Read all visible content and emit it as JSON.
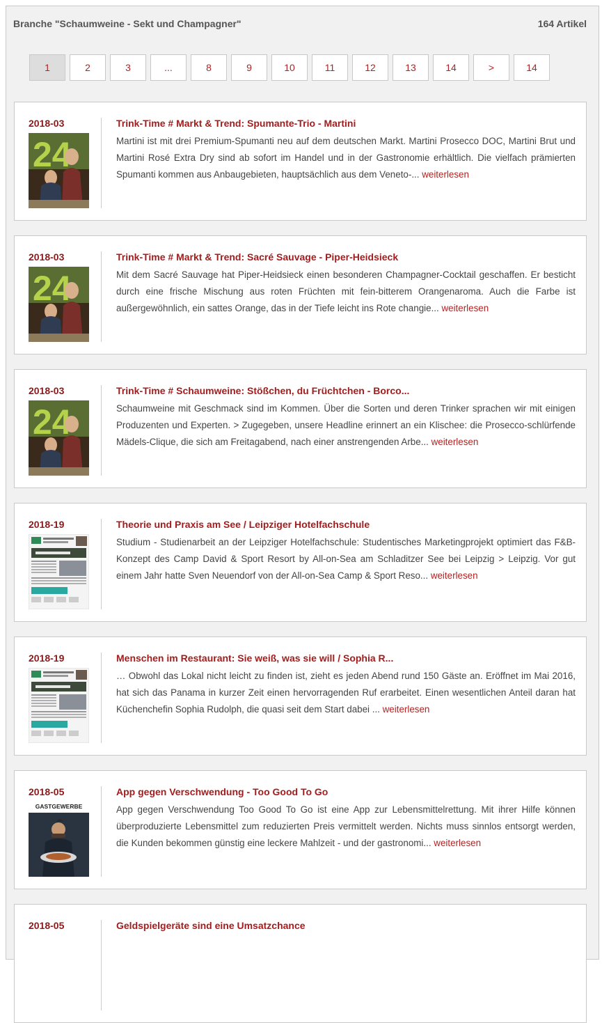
{
  "header": {
    "title": "Branche \"Schaumweine - Sekt und Champagner\"",
    "count": "164 Artikel"
  },
  "pagination": [
    "1",
    "2",
    "3",
    "...",
    "8",
    "9",
    "10",
    "11",
    "12",
    "13",
    "14",
    ">",
    "14"
  ],
  "articles": [
    {
      "date": "2018-03",
      "cover": "magazine-24-cover",
      "title": "Trink-Time # Markt & Trend: Spumante-Trio - Martini",
      "excerpt": "Martini ist mit drei Premium-Spumanti neu auf dem deutschen Markt. Martini Prosecco DOC, Martini Brut und Martini Rosé Extra Dry sind ab sofort im Handel und in der Gastronomie erhältlich. Die vielfach prämierten Spumanti kommen aus Anbaugebieten, hauptsächlich aus dem Veneto-... ",
      "more": "weiterlesen"
    },
    {
      "date": "2018-03",
      "cover": "magazine-24-cover",
      "title": "Trink-Time # Markt & Trend: Sacré Sauvage - Piper-Heidsieck",
      "excerpt": "Mit dem Sacré Sauvage hat Piper-Heidsieck einen besonderen Champagner-Cocktail geschaffen. Er besticht durch eine frische Mischung aus roten Früchten mit fein-bitterem Orangenaroma. Auch die Farbe ist außergewöhnlich, ein sattes Orange, das in der Tiefe leicht ins Rote changie... ",
      "more": "weiterlesen"
    },
    {
      "date": "2018-03",
      "cover": "magazine-24-cover",
      "title": "Trink-Time # Schaumweine: Stößchen, du Früchtchen - Borco...",
      "excerpt": "Schaumweine mit Geschmack sind im Kommen. Über die Sorten und deren Trinker sprachen wir mit einigen Produzenten und Experten. > Zugegeben, unsere Headline erinnert an ein Klischee: die Prosecco-schlürfende Mädels-Clique, die sich am Freitagabend, nach einer anstrengenden Arbe... ",
      "more": "weiterlesen"
    },
    {
      "date": "2018-19",
      "cover": "newspaper-cover",
      "title": "Theorie und Praxis am See / Leipziger Hotelfachschule",
      "excerpt": "Studium - Studienarbeit an der Leipziger Hotelfachschule: Studentisches Marketingprojekt optimiert das F&B-Konzept des Camp David & Sport Resort by All-on-Sea am Schladitzer See bei Leipzig > Leipzig. Vor gut einem Jahr hatte Sven Neuendorf von der All-on-Sea Camp & Sport Reso... ",
      "more": "weiterlesen"
    },
    {
      "date": "2018-19",
      "cover": "newspaper-cover",
      "title": "Menschen im Restaurant: Sie weiß, was sie will / Sophia R...",
      "excerpt": "… Obwohl das Lokal nicht leicht zu finden ist, zieht es jeden Abend rund 150 Gäste an. Eröffnet im Mai 2016, hat sich das Panama in kurzer Zeit einen hervorragenden Ruf erarbeitet. Einen wesentlichen Anteil daran hat Küchenchefin Sophia Rudolph, die quasi seit dem Start dabei ... ",
      "more": "weiterlesen"
    },
    {
      "date": "2018-05",
      "cover": "gastgewerbe-cover",
      "cover_label": "GASTGEWERBE",
      "title": "App gegen Verschwendung - Too Good To Go",
      "excerpt": "App gegen Verschwendung Too Good To Go ist eine App zur Lebensmittelrettung. Mit ihrer Hilfe können überproduzierte Lebensmittel zum reduzierten Preis vermittelt werden. Nichts muss sinnlos entsorgt werden, die Kunden bekommen günstig eine leckere Mahlzeit - und der gastronomi... ",
      "more": "weiterlesen"
    },
    {
      "date": "2018-05",
      "title": "Geldspielgeräte sind eine Umsatzchance",
      "excerpt": "",
      "more": ""
    }
  ],
  "colors": {
    "accent": "#a51c1c",
    "background": "#f1f1f1",
    "card": "#ffffff"
  }
}
